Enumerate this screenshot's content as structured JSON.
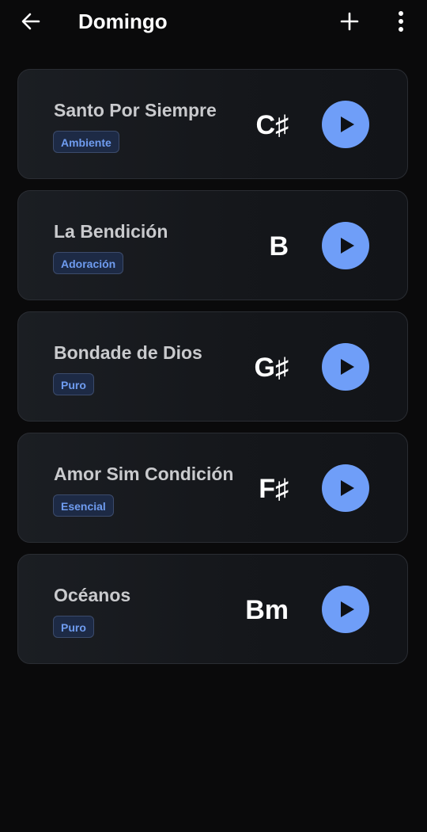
{
  "header": {
    "title": "Domingo",
    "back_icon": "arrow-left-icon",
    "add_icon": "plus-icon",
    "more_icon": "more-vertical-icon"
  },
  "colors": {
    "background": "#0a0a0b",
    "accent": "#6f9ef8",
    "tag_text": "#6f9cf0",
    "tag_bg": "#1d2a45"
  },
  "songs": [
    {
      "title": "Santo Por Siempre",
      "tag": "Ambiente",
      "key": "C♯"
    },
    {
      "title": "La Bendición",
      "tag": "Adoración",
      "key": "B"
    },
    {
      "title": "Bondade de Dios",
      "tag": "Puro",
      "key": "G♯"
    },
    {
      "title": "Amor Sim Condición",
      "tag": "Esencial",
      "key": "F♯"
    },
    {
      "title": "Océanos",
      "tag": "Puro",
      "key": "Bm"
    }
  ]
}
